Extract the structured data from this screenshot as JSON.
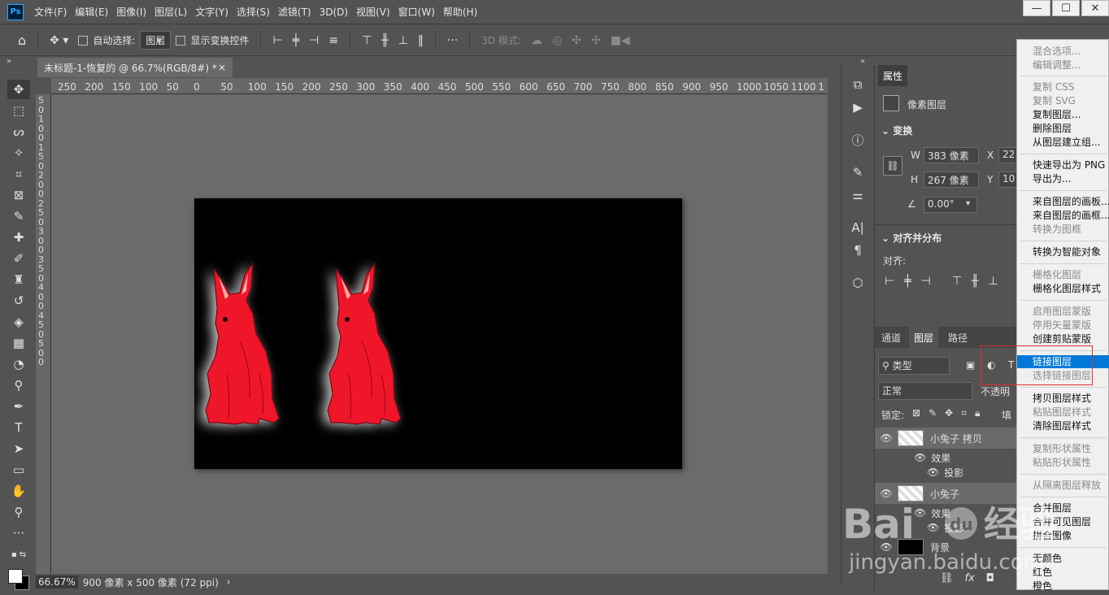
{
  "app": {
    "logo": "Ps"
  },
  "menu": [
    "文件(F)",
    "编辑(E)",
    "图像(I)",
    "图层(L)",
    "文字(Y)",
    "选择(S)",
    "滤镜(T)",
    "3D(D)",
    "视图(V)",
    "窗口(W)",
    "帮助(H)"
  ],
  "window_controls": {
    "min": "—",
    "max": "☐",
    "close": "✕"
  },
  "options": {
    "auto_select": "自动选择:",
    "target": "图层",
    "transform": "显示变换控件",
    "more": "···",
    "mode3d": "3D 模式:"
  },
  "doc_tab": {
    "title": "未标题-1-恢复的 @ 66.7%(RGB/8#) *",
    "close": "×"
  },
  "ruler_h": [
    "250",
    "200",
    "150",
    "100",
    "50",
    "0",
    "50",
    "100",
    "150",
    "200",
    "250",
    "300",
    "350",
    "400",
    "450",
    "500",
    "550",
    "600",
    "650",
    "700",
    "750",
    "800",
    "850",
    "900",
    "950",
    "1000",
    "1050",
    "1100",
    "1"
  ],
  "ruler_v": [
    "5",
    "0",
    "1",
    "0",
    "0",
    "1",
    "5",
    "0",
    "2",
    "0",
    "0",
    "2",
    "5",
    "0",
    "3",
    "0",
    "0",
    "3",
    "5",
    "0",
    "4",
    "0",
    "0",
    "4",
    "5",
    "0",
    "5",
    "0",
    "0"
  ],
  "status": {
    "zoom": "66.67%",
    "info": "900 像素 x 500 像素 (72 ppi)",
    "arrow": "›"
  },
  "properties": {
    "tab": "属性",
    "kind": "像素图层",
    "transform_title": "变换",
    "w_label": "W",
    "w_value": "383 像素",
    "x_label": "X",
    "x_value": "22",
    "h_label": "H",
    "h_value": "267 像素",
    "y_label": "Y",
    "y_value": "10",
    "angle": "0.00°",
    "align_title": "对齐并分布",
    "align_label": "对齐:"
  },
  "layers": {
    "tabs": [
      "通道",
      "图层",
      "路径"
    ],
    "filter": "类型",
    "blend": "正常",
    "opacity_label": "不透明",
    "lock_label": "锁定:",
    "fill_label": "填",
    "items": [
      {
        "name": "小兔子 拷贝"
      },
      {
        "name": "效果"
      },
      {
        "name": "投影"
      },
      {
        "name": "小兔子"
      },
      {
        "name": "效果"
      },
      {
        "name": "投影"
      },
      {
        "name": "背景"
      }
    ]
  },
  "context_menu": [
    {
      "label": "混合选项...",
      "disabled": true
    },
    {
      "label": "编辑调整...",
      "disabled": true
    },
    {
      "label": "复制 CSS",
      "disabled": true
    },
    {
      "label": "复制 SVG",
      "disabled": true
    },
    {
      "label": "复制图层...",
      "disabled": false
    },
    {
      "label": "删除图层",
      "disabled": false
    },
    {
      "label": "从图层建立组...",
      "disabled": false
    },
    {
      "label": "快速导出为 PNG",
      "disabled": false
    },
    {
      "label": "导出为...",
      "disabled": false
    },
    {
      "label": "来自图层的画板...",
      "disabled": false
    },
    {
      "label": "来自图层的画框...",
      "disabled": false
    },
    {
      "label": "转换为图框",
      "disabled": true
    },
    {
      "label": "转换为智能对象",
      "disabled": false
    },
    {
      "label": "栅格化图层",
      "disabled": true
    },
    {
      "label": "栅格化图层样式",
      "disabled": false
    },
    {
      "label": "启用图层蒙版",
      "disabled": true
    },
    {
      "label": "停用矢量蒙版",
      "disabled": true
    },
    {
      "label": "创建剪贴蒙版",
      "disabled": false
    },
    {
      "label": "链接图层",
      "disabled": false,
      "highlighted": true
    },
    {
      "label": "选择链接图层",
      "disabled": true
    },
    {
      "label": "拷贝图层样式",
      "disabled": false
    },
    {
      "label": "粘贴图层样式",
      "disabled": true
    },
    {
      "label": "清除图层样式",
      "disabled": false
    },
    {
      "label": "复制形状属性",
      "disabled": true
    },
    {
      "label": "粘贴形状属性",
      "disabled": true
    },
    {
      "label": "从隔离图层释放",
      "disabled": true
    },
    {
      "label": "合并图层",
      "disabled": false
    },
    {
      "label": "合并可见图层",
      "disabled": false
    },
    {
      "label": "拼合图像",
      "disabled": false
    },
    {
      "label": "无颜色",
      "disabled": false
    },
    {
      "label": "红色",
      "disabled": false
    },
    {
      "label": "橙色",
      "disabled": false
    }
  ],
  "watermark": {
    "brand": "Bai",
    "paw": "du",
    "cn": "经验",
    "url": "jingyan.baidu.com"
  },
  "colors": {
    "rabbit": "#f0142a",
    "ear_inner": "#f5b0a8",
    "highlight": "#0078d7",
    "annotation": "#e03030"
  }
}
